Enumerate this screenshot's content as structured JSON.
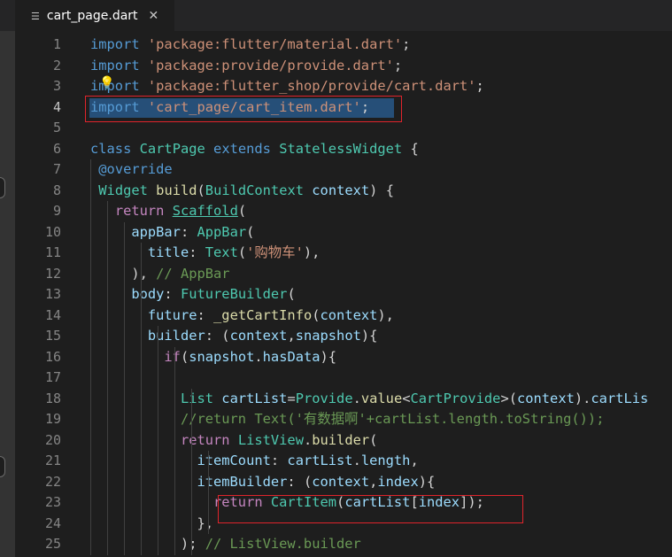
{
  "tab": {
    "icon": "list-icon",
    "title": "cart_page.dart",
    "close_glyph": "✕"
  },
  "colors": {
    "highlight_box": "#e0242c",
    "selection": "#264f78",
    "bulb": "#ffcc00"
  },
  "lines": [
    {
      "number": "1",
      "tokens": [
        [
          "kw",
          "import"
        ],
        [
          "",
          "' "
        ],
        [
          "str",
          "'package:flutter/material.dart'"
        ],
        [
          "",
          ";"
        ]
      ]
    },
    {
      "number": "2",
      "tokens": [
        [
          "kw",
          "import"
        ],
        [
          "",
          "' "
        ],
        [
          "str",
          "'package:provide/provide.dart'"
        ],
        [
          "",
          ";"
        ]
      ]
    },
    {
      "number": "3",
      "tokens": [
        [
          "kw",
          "import"
        ],
        [
          "",
          "' "
        ],
        [
          "str",
          "'package:flutter_shop/provide/cart.dart'"
        ],
        [
          "",
          ";"
        ]
      ]
    },
    {
      "number": "4",
      "tokens": [
        [
          "kw",
          "import"
        ],
        [
          "",
          "' "
        ],
        [
          "str",
          "'cart_page/cart_item.dart'"
        ],
        [
          "",
          ";"
        ]
      ]
    },
    {
      "number": "5",
      "tokens": []
    },
    {
      "number": "6",
      "tokens": [
        [
          "kw",
          "class"
        ],
        [
          "",
          " "
        ],
        [
          "cls",
          "CartPage"
        ],
        [
          "",
          " "
        ],
        [
          "kw",
          "extends"
        ],
        [
          "",
          " "
        ],
        [
          "cls",
          "StatelessWidget"
        ],
        [
          "",
          " {"
        ]
      ]
    },
    {
      "number": "7",
      "tokens": [
        [
          "",
          " "
        ],
        [
          "kw",
          "@override"
        ]
      ]
    },
    {
      "number": "8",
      "tokens": [
        [
          "",
          " "
        ],
        [
          "cls",
          "Widget"
        ],
        [
          "",
          " "
        ],
        [
          "fn",
          "build"
        ],
        [
          "",
          "("
        ],
        [
          "cls",
          "BuildContext"
        ],
        [
          "",
          " "
        ],
        [
          "var",
          "context"
        ],
        [
          "",
          ") {"
        ]
      ]
    },
    {
      "number": "9",
      "tokens": [
        [
          "",
          "   "
        ],
        [
          "ctrl",
          "return"
        ],
        [
          "",
          " "
        ],
        [
          "cls ul",
          "Scaffold"
        ],
        [
          "",
          "("
        ]
      ]
    },
    {
      "number": "10",
      "tokens": [
        [
          "",
          "     "
        ],
        [
          "var",
          "appBar"
        ],
        [
          "",
          ": "
        ],
        [
          "cls",
          "AppBar"
        ],
        [
          "",
          "("
        ]
      ]
    },
    {
      "number": "11",
      "tokens": [
        [
          "",
          "       "
        ],
        [
          "var",
          "title"
        ],
        [
          "",
          ": "
        ],
        [
          "cls",
          "Text"
        ],
        [
          "",
          "("
        ],
        [
          "str",
          "'购物车'"
        ],
        [
          "",
          "),"
        ]
      ]
    },
    {
      "number": "12",
      "tokens": [
        [
          "",
          "     ), "
        ],
        [
          "cmt",
          "// AppBar"
        ]
      ]
    },
    {
      "number": "13",
      "tokens": [
        [
          "",
          "     "
        ],
        [
          "var",
          "body"
        ],
        [
          "",
          ": "
        ],
        [
          "cls",
          "FutureBuilder"
        ],
        [
          "",
          "("
        ]
      ]
    },
    {
      "number": "14",
      "tokens": [
        [
          "",
          "       "
        ],
        [
          "var",
          "future"
        ],
        [
          "",
          ": "
        ],
        [
          "fn",
          "_getCartInfo"
        ],
        [
          "",
          "("
        ],
        [
          "var",
          "context"
        ],
        [
          "",
          "),"
        ]
      ]
    },
    {
      "number": "15",
      "tokens": [
        [
          "",
          "       "
        ],
        [
          "var",
          "builder"
        ],
        [
          "",
          ": ("
        ],
        [
          "var",
          "context"
        ],
        [
          "",
          ","
        ],
        [
          "var",
          "snapshot"
        ],
        [
          "",
          "){"
        ]
      ]
    },
    {
      "number": "16",
      "tokens": [
        [
          "",
          "         "
        ],
        [
          "ctrl",
          "if"
        ],
        [
          "",
          "("
        ],
        [
          "var",
          "snapshot"
        ],
        [
          "",
          "."
        ],
        [
          "var",
          "hasData"
        ],
        [
          "",
          "){"
        ]
      ]
    },
    {
      "number": "17",
      "tokens": []
    },
    {
      "number": "18",
      "tokens": [
        [
          "",
          "           "
        ],
        [
          "cls",
          "List"
        ],
        [
          "",
          " "
        ],
        [
          "var",
          "cartList"
        ],
        [
          "",
          "="
        ],
        [
          "cls",
          "Provide"
        ],
        [
          "",
          "."
        ],
        [
          "fn",
          "value"
        ],
        [
          "",
          "<"
        ],
        [
          "cls",
          "CartProvide"
        ],
        [
          "",
          ">("
        ],
        [
          "var",
          "context"
        ],
        [
          "",
          ")."
        ],
        [
          "var",
          "cartLis"
        ]
      ]
    },
    {
      "number": "19",
      "tokens": [
        [
          "",
          "           "
        ],
        [
          "cmt",
          "//return Text('有数据啊'+cartList.length.toString());"
        ]
      ]
    },
    {
      "number": "20",
      "tokens": [
        [
          "",
          "           "
        ],
        [
          "ctrl",
          "return"
        ],
        [
          "",
          " "
        ],
        [
          "cls",
          "ListView"
        ],
        [
          "",
          "."
        ],
        [
          "fn",
          "builder"
        ],
        [
          "",
          "("
        ]
      ]
    },
    {
      "number": "21",
      "tokens": [
        [
          "",
          "             "
        ],
        [
          "var",
          "itemCount"
        ],
        [
          "",
          ": "
        ],
        [
          "var",
          "cartList"
        ],
        [
          "",
          "."
        ],
        [
          "var",
          "length"
        ],
        [
          "",
          ","
        ]
      ]
    },
    {
      "number": "22",
      "tokens": [
        [
          "",
          "             "
        ],
        [
          "var",
          "itemBuilder"
        ],
        [
          "",
          ": ("
        ],
        [
          "var",
          "context"
        ],
        [
          "",
          ","
        ],
        [
          "var",
          "index"
        ],
        [
          "",
          "){"
        ]
      ]
    },
    {
      "number": "23",
      "tokens": [
        [
          "",
          "               "
        ],
        [
          "ctrl",
          "return"
        ],
        [
          "",
          " "
        ],
        [
          "cls",
          "CartItem"
        ],
        [
          "",
          "("
        ],
        [
          "var",
          "cartList"
        ],
        [
          "",
          "["
        ],
        [
          "var",
          "index"
        ],
        [
          "",
          "]);"
        ]
      ]
    },
    {
      "number": "24",
      "tokens": [
        [
          "",
          "             },"
        ]
      ]
    },
    {
      "number": "25",
      "tokens": [
        [
          "",
          "           ); "
        ],
        [
          "cmt",
          "// ListView.builder"
        ]
      ]
    }
  ]
}
